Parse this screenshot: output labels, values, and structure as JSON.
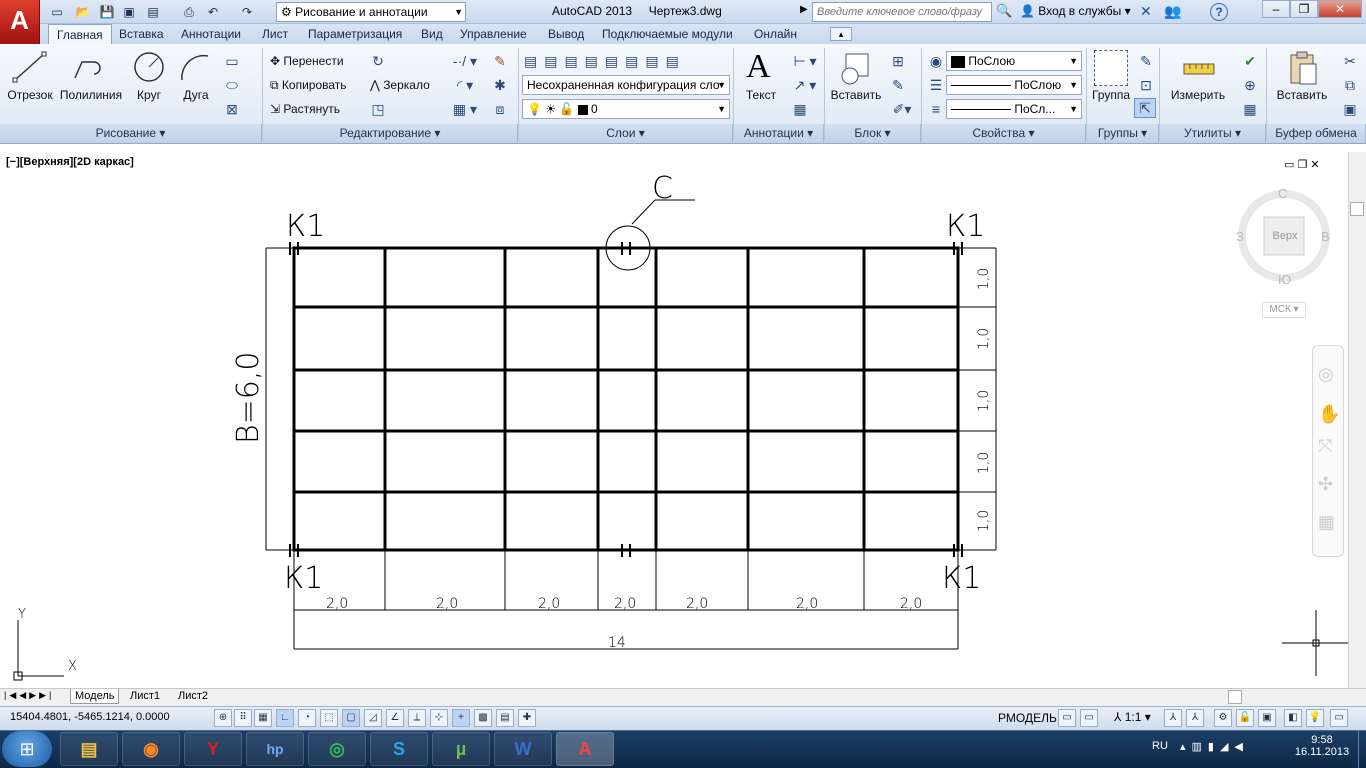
{
  "window": {
    "app_title": "AutoCAD 2013",
    "file_title": "Чертеж3.dwg",
    "app_button_label": "A",
    "workspace": "Рисование и аннотации",
    "search_placeholder": "Введите ключевое слово/фразу",
    "signin": "Вход в службы",
    "help": "?"
  },
  "tabs": [
    "Главная",
    "Вставка",
    "Аннотации",
    "Лист",
    "Параметризация",
    "Вид",
    "Управление",
    "Вывод",
    "Подключаемые модули",
    "Онлайн"
  ],
  "ribbon": {
    "draw": {
      "title": "Рисование",
      "line": "Отрезок",
      "polyline": "Полилиния",
      "circle": "Круг",
      "arc": "Дуга"
    },
    "modify": {
      "title": "Редактирование",
      "move": "Перенести",
      "copy": "Копировать",
      "stretch": "Растянуть",
      "mirror": "Зеркало"
    },
    "layers": {
      "title": "Слои",
      "layer_state": "Несохраненная конфигурация сло",
      "layer_current": "0"
    },
    "annotation": {
      "title": "Аннотации",
      "text": "Текст"
    },
    "block": {
      "title": "Блок",
      "insert": "Вставить"
    },
    "properties": {
      "title": "Свойства",
      "color": "ПоСлою",
      "linetype": "ПоСлою",
      "lineweight": "ПоСл..."
    },
    "groups": {
      "title": "Группы",
      "group": "Группа"
    },
    "utilities": {
      "title": "Утилиты",
      "measure": "Измерить"
    },
    "clipboard": {
      "title": "Буфер обмена",
      "paste": "Вставить"
    }
  },
  "viewport": {
    "label": "[−][Верхняя][2D каркас]",
    "navcube": {
      "top": "Верх",
      "n": "С",
      "s": "Ю",
      "w": "З",
      "e": "В",
      "ucs": "МСК"
    }
  },
  "drawing": {
    "corner_labels": [
      "К1",
      "К1",
      "К1",
      "К1"
    ],
    "callout": "С",
    "height_label": "B=6,0",
    "row_dims": [
      "1,0",
      "1,0",
      "1,0",
      "1,0",
      "1,0"
    ],
    "col_dims": [
      "2,0",
      "2,0",
      "2,0",
      "2,0",
      "2,0",
      "2,0",
      "2,0"
    ],
    "total_dim": "14"
  },
  "layout_tabs": [
    "Модель",
    "Лист1",
    "Лист2"
  ],
  "status": {
    "coords": "15404.4801, -5465.1214, 0.0000",
    "model": "РМОДЕЛЬ",
    "scale": "1:1"
  },
  "taskbar": {
    "lang": "RU",
    "time": "9:58",
    "date": "16.11.2013"
  }
}
